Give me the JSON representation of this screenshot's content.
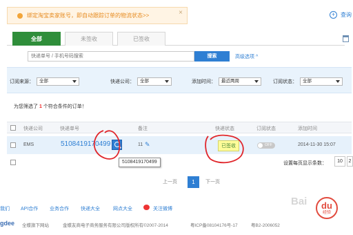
{
  "banner": {
    "text": "绑定淘宝卖家账号，即自动跟踪订单的物流状态>>",
    "close": "×"
  },
  "top_actions": {
    "add_label": "查询",
    "add_symbol": "+"
  },
  "tabs": [
    {
      "label": "全部"
    },
    {
      "label": "未签收"
    },
    {
      "label": "已签收"
    }
  ],
  "search": {
    "placeholder": "快递单号 / 手机号码搜索",
    "button": "搜索",
    "advanced": "高级选项 ^"
  },
  "filters": [
    {
      "label": "订阅来源：",
      "value": "全部"
    },
    {
      "label": "快递公司：",
      "value": "全部"
    },
    {
      "label": "添加时间：",
      "value": "最近两周"
    },
    {
      "label": "订阅状态：",
      "value": "全部"
    }
  ],
  "result": {
    "prefix": "为您筛选了",
    "count": "1",
    "suffix": "个符合条件的订单！"
  },
  "table": {
    "headers": [
      "快递公司",
      "快递单号",
      "备注",
      "快递状态",
      "订阅状态",
      "添加时间"
    ],
    "rows": [
      {
        "company": "EMS",
        "tracking": "5108419170499",
        "remark": "11",
        "status": "已签收",
        "subscribe": "OFF",
        "time": "2014-11-30 15:07"
      }
    ]
  },
  "tooltip": "5108419170499",
  "page_size": {
    "label": "设置每页显示条数：",
    "options": [
      "10",
      "2"
    ]
  },
  "pagination": {
    "prev": "上一页",
    "current": "1",
    "next": "下一页"
  },
  "footer_links": [
    "我们",
    "API合作",
    "业务合作",
    "快递大全",
    "网点大全",
    "关注微博"
  ],
  "footer": {
    "brand": "gdee",
    "items": [
      "全蝶旗下网站",
      "金蝶友商电子商务服务有限公司版权所有©2007-2014",
      "粤ICP备08104176号-17",
      "粤B2-2006052"
    ]
  },
  "watermark": {
    "text": "Bai",
    "logo_main": "du",
    "logo_sub": "经验"
  },
  "colors": {
    "accent": "#2f7fd3",
    "tab_active": "#2f8e3a",
    "banner_text": "#e68a1e",
    "annotation": "#e0262b"
  }
}
